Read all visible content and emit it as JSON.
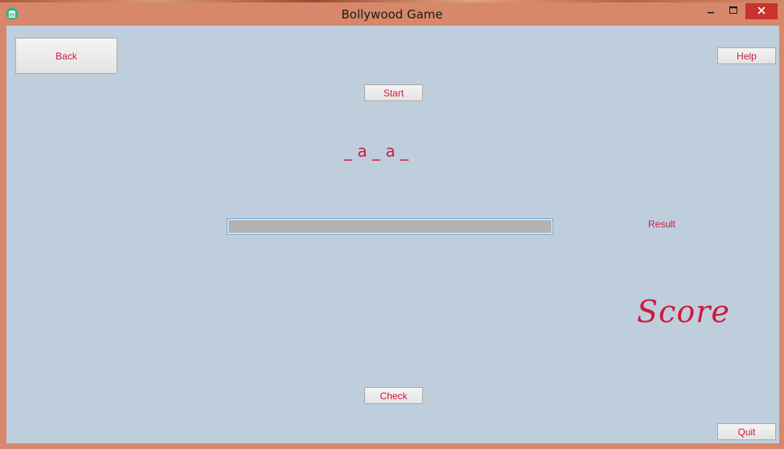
{
  "window": {
    "title": "Bollywood Game",
    "icon": "app-icon",
    "controls": {
      "minimize": "—",
      "maximize": "□",
      "close": "✕"
    }
  },
  "buttons": {
    "back": "Back",
    "help": "Help",
    "start": "Start",
    "check": "Check",
    "quit": "Quit"
  },
  "game": {
    "puzzle": "_ a _ a _",
    "answer_value": "",
    "result": "Result",
    "score": "Score"
  },
  "colors": {
    "frame": "#d7876a",
    "client_background": "#bfcedc",
    "text_accent": "#d0193b",
    "close_button": "#c9322e",
    "input_background": "#b3b3b3",
    "input_border": "#5ea1d6"
  }
}
